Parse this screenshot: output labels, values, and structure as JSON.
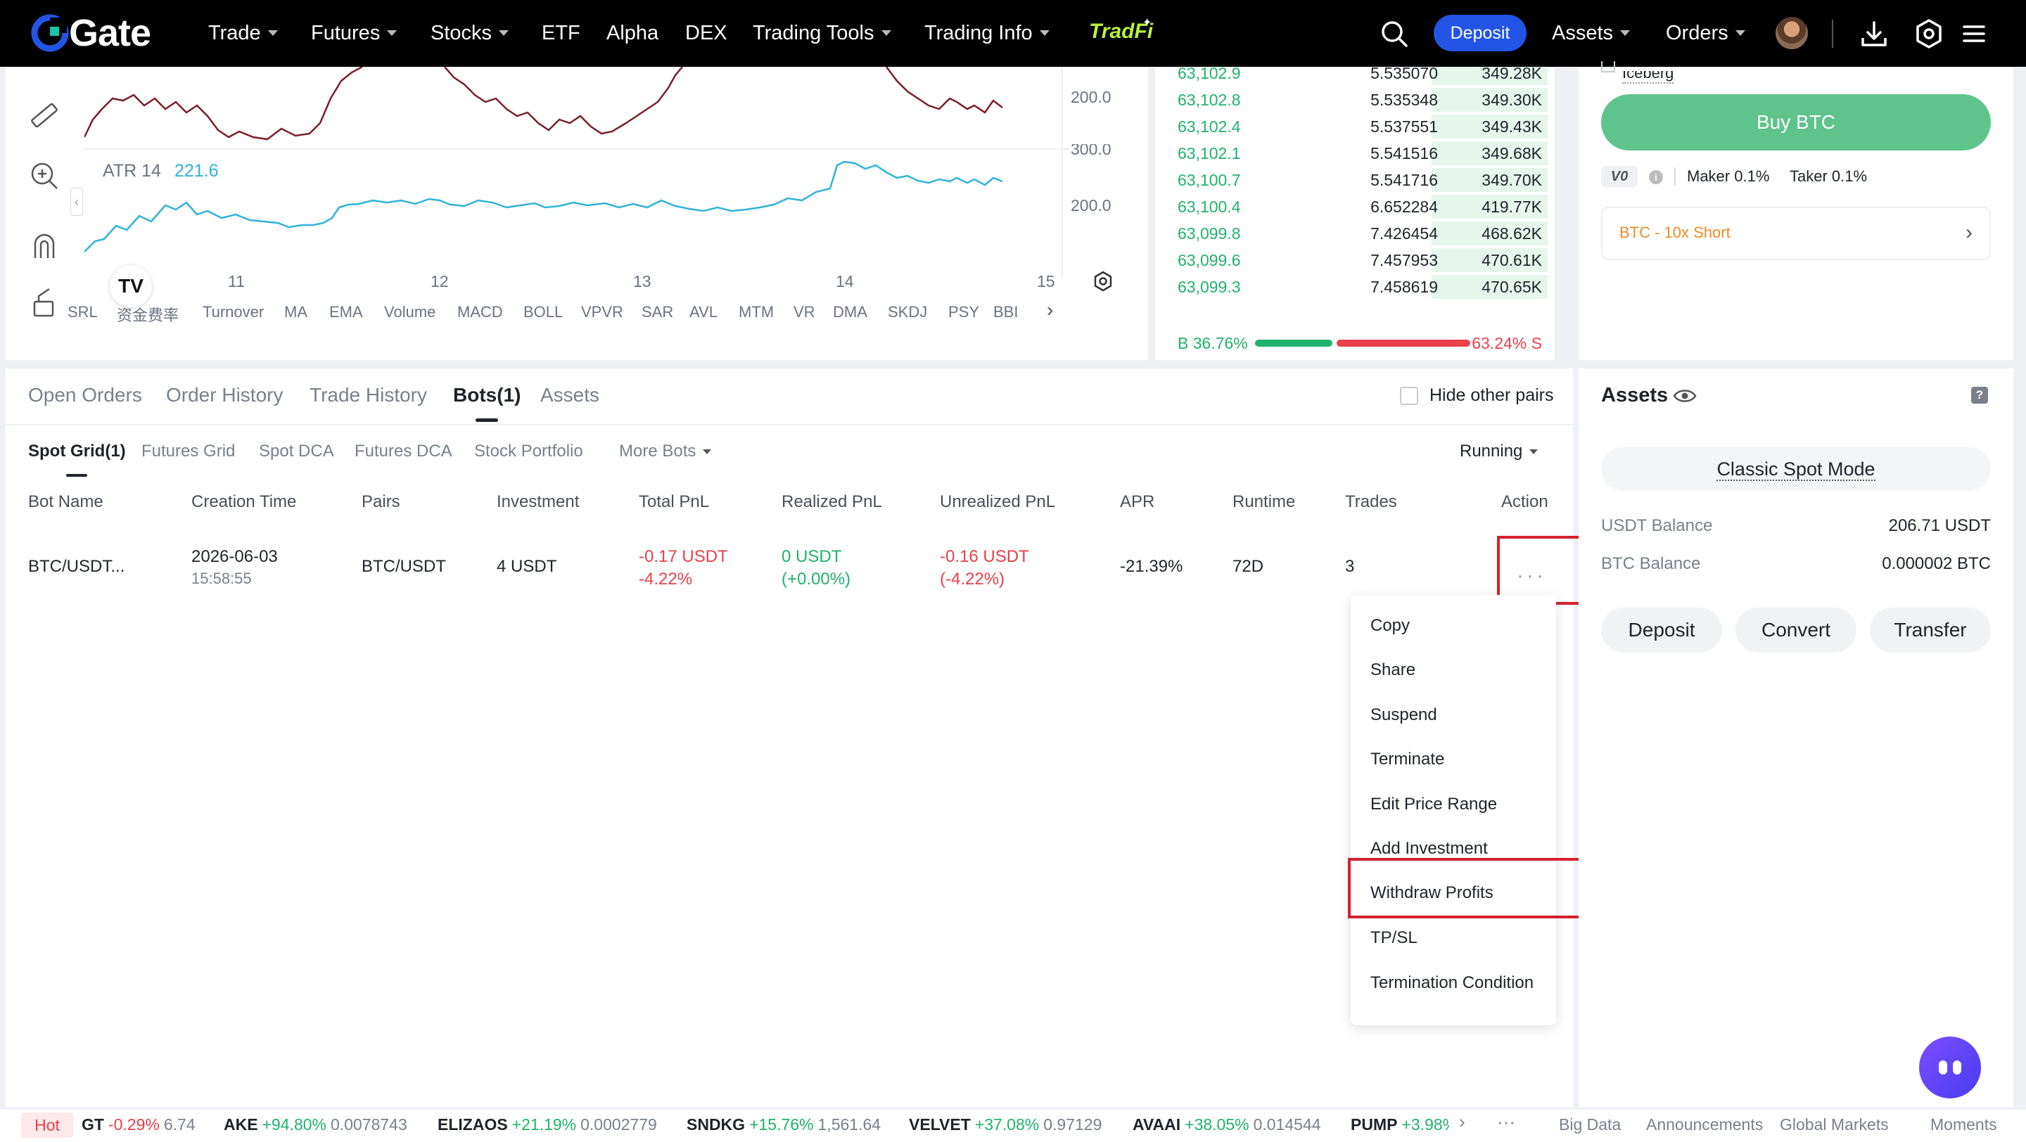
{
  "nav": {
    "logo": "Gate",
    "items": [
      {
        "label": "Trade",
        "caret": true
      },
      {
        "label": "Futures",
        "caret": true
      },
      {
        "label": "Stocks",
        "caret": true
      },
      {
        "label": "ETF",
        "caret": false
      },
      {
        "label": "Alpha",
        "caret": false
      },
      {
        "label": "DEX",
        "caret": false
      },
      {
        "label": "Trading Tools",
        "caret": true
      },
      {
        "label": "Trading Info",
        "caret": true
      }
    ],
    "tradfi": "TradFi",
    "deposit": "Deposit",
    "assets": "Assets",
    "orders": "Orders"
  },
  "chart": {
    "atr_label": "ATR 14",
    "atr_value": "221.6",
    "axis_values": [
      "200.0",
      "300.0",
      "200.0"
    ],
    "date_ticks": [
      "11",
      "12",
      "13",
      "14",
      "15"
    ],
    "indicators": [
      "SRL",
      "资金费率",
      "Turnover",
      "MA",
      "EMA",
      "Volume",
      "MACD",
      "BOLL",
      "VPVR",
      "SAR",
      "AVL",
      "MTM",
      "VR",
      "DMA",
      "SKDJ",
      "PSY",
      "BBI"
    ],
    "tv_badge": "TV",
    "colors": {
      "upper_line": "#7a1f2b",
      "atr_line": "#2fb3d7"
    }
  },
  "orderbook": {
    "rows": [
      {
        "price": "63,102.9",
        "amount": "5.535070",
        "total": "349.28K",
        "depth": 0.5
      },
      {
        "price": "63,102.8",
        "amount": "5.535348",
        "total": "349.30K",
        "depth": 0.5
      },
      {
        "price": "63,102.4",
        "amount": "5.537551",
        "total": "349.43K",
        "depth": 0.5
      },
      {
        "price": "63,102.1",
        "amount": "5.541516",
        "total": "349.68K",
        "depth": 0.5
      },
      {
        "price": "63,100.7",
        "amount": "5.541716",
        "total": "349.70K",
        "depth": 0.5
      },
      {
        "price": "63,100.4",
        "amount": "6.652284",
        "total": "419.77K",
        "depth": 0.5
      },
      {
        "price": "63,099.8",
        "amount": "7.426454",
        "total": "468.62K",
        "depth": 0.5
      },
      {
        "price": "63,099.6",
        "amount": "7.457953",
        "total": "470.61K",
        "depth": 0.5
      },
      {
        "price": "63,099.3",
        "amount": "7.458619",
        "total": "470.65K",
        "depth": 0.5
      }
    ],
    "buy_ratio": "B 36.76%",
    "sell_ratio": "63.24% S",
    "buy_fraction": 0.3676
  },
  "buy_panel": {
    "iceberg": "Iceberg",
    "buy_button": "Buy BTC",
    "vip": "V0",
    "maker_fee": "Maker 0.1%",
    "taker_fee": "Taker 0.1%",
    "short_link": "BTC - 10x Short"
  },
  "orders": {
    "tabs": [
      "Open Orders",
      "Order History",
      "Trade History",
      "Bots(1)",
      "Assets"
    ],
    "active_tab": "Bots(1)",
    "hide_other_pairs": "Hide other pairs",
    "subtabs": [
      "Spot Grid(1)",
      "Futures Grid",
      "Spot DCA",
      "Futures DCA",
      "Stock Portfolio",
      "More Bots"
    ],
    "running_filter": "Running",
    "columns": [
      "Bot Name",
      "Creation Time",
      "Pairs",
      "Investment",
      "Total PnL",
      "Realized PnL",
      "Unrealized PnL",
      "APR",
      "Runtime",
      "Trades",
      "Action"
    ],
    "row": {
      "bot_name": "BTC/USDT...",
      "creation_date": "2026-06-03",
      "creation_time": "15:58:55",
      "pair": "BTC/USDT",
      "investment": "4 USDT",
      "total_pnl": "-0.17 USDT",
      "total_pnl_pct": "-4.22%",
      "realized_pnl": "0 USDT",
      "realized_pnl_pct": "(+0.00%)",
      "unrealized_pnl": "-0.16 USDT",
      "unrealized_pnl_pct": "(-4.22%)",
      "apr": "-21.39%",
      "runtime": "72D",
      "trades": "3",
      "action": "···"
    },
    "menu": [
      "Copy",
      "Share",
      "Suspend",
      "Terminate",
      "Edit Price Range",
      "Add Investment",
      "Withdraw Profits",
      "TP/SL",
      "Termination Condition"
    ]
  },
  "assets": {
    "title": "Assets",
    "help": "?",
    "mode": "Classic Spot Mode",
    "usdt_label": "USDT Balance",
    "usdt_value": "206.71 USDT",
    "btc_label": "BTC Balance",
    "btc_value": "0.000002 BTC",
    "buttons": [
      "Deposit",
      "Convert",
      "Transfer"
    ]
  },
  "ticker": {
    "hot": "Hot",
    "items": [
      {
        "symbol": "GT",
        "change": "-0.29%",
        "price": "6.74",
        "up": false
      },
      {
        "symbol": "AKE",
        "change": "+94.80%",
        "price": "0.0078743",
        "up": true
      },
      {
        "symbol": "ELIZAOS",
        "change": "+21.19%",
        "price": "0.0002779",
        "up": true
      },
      {
        "symbol": "SNDKG",
        "change": "+15.76%",
        "price": "1,561.64",
        "up": true
      },
      {
        "symbol": "VELVET",
        "change": "+37.08%",
        "price": "0.97129",
        "up": true
      },
      {
        "symbol": "AVAAI",
        "change": "+38.05%",
        "price": "0.014544",
        "up": true
      },
      {
        "symbol": "PUMP",
        "change": "+3.98%",
        "price": "",
        "up": true
      }
    ],
    "links": [
      "Big Data",
      "Announcements",
      "Global Markets",
      "Moments"
    ]
  }
}
